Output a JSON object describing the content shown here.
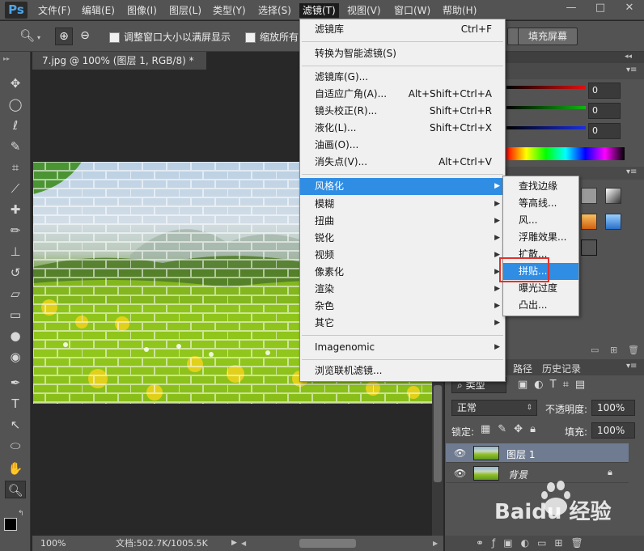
{
  "app": {
    "logo": "Ps"
  },
  "menubar": {
    "items": [
      "文件(F)",
      "编辑(E)",
      "图像(I)",
      "图层(L)",
      "类型(Y)",
      "选择(S)",
      "滤镜(T)",
      "视图(V)",
      "窗口(W)",
      "帮助(H)"
    ],
    "window_controls": [
      "—",
      "□",
      "✕"
    ]
  },
  "options_bar": {
    "zoom_in_icon": "⊕",
    "zoom_out_icon": "⊖",
    "resize_window_label": "调整窗口大小以满屏显示",
    "zoom_all_label": "缩放所有",
    "fill_screen_label": "填充屏幕"
  },
  "document": {
    "tab_title": "7.jpg @ 100% (图层 1, RGB/8) *",
    "zoom": "100%",
    "doc_info": "文档:502.7K/1005.5K"
  },
  "filter_menu": {
    "items": [
      {
        "label": "滤镜库",
        "shortcut": "Ctrl+F"
      },
      {
        "label": "转换为智能滤镜(S)",
        "shortcut": ""
      },
      {
        "label": "滤镜库(G)...",
        "shortcut": ""
      },
      {
        "label": "自适应广角(A)...",
        "shortcut": "Alt+Shift+Ctrl+A"
      },
      {
        "label": "镜头校正(R)...",
        "shortcut": "Shift+Ctrl+R"
      },
      {
        "label": "液化(L)...",
        "shortcut": "Shift+Ctrl+X"
      },
      {
        "label": "油画(O)...",
        "shortcut": ""
      },
      {
        "label": "消失点(V)...",
        "shortcut": "Alt+Ctrl+V"
      },
      {
        "label": "风格化",
        "shortcut": ""
      },
      {
        "label": "模糊",
        "shortcut": ""
      },
      {
        "label": "扭曲",
        "shortcut": ""
      },
      {
        "label": "锐化",
        "shortcut": ""
      },
      {
        "label": "视频",
        "shortcut": ""
      },
      {
        "label": "像素化",
        "shortcut": ""
      },
      {
        "label": "渲染",
        "shortcut": ""
      },
      {
        "label": "杂色",
        "shortcut": ""
      },
      {
        "label": "其它",
        "shortcut": ""
      },
      {
        "label": "Imagenomic",
        "shortcut": ""
      },
      {
        "label": "浏览联机滤镜...",
        "shortcut": ""
      }
    ],
    "submenu_arrow": "▶"
  },
  "stylize_submenu": {
    "items": [
      "查找边缘",
      "等高线...",
      "风...",
      "浮雕效果...",
      "扩散...",
      "拼贴...",
      "曝光过度",
      "凸出..."
    ],
    "highlighted": "拼贴..."
  },
  "color_panel": {
    "values": [
      "0",
      "0",
      "0"
    ]
  },
  "layers_panel": {
    "tabs": [
      "路径",
      "历史记录"
    ],
    "filter_type": "类型",
    "blend_mode": "正常",
    "opacity_label": "不透明度:",
    "opacity_value": "100%",
    "lock_label": "锁定:",
    "fill_label": "填充:",
    "fill_value": "100%",
    "layers": [
      {
        "name": "图层 1",
        "selected": true
      },
      {
        "name": "背景",
        "selected": false,
        "locked": true
      }
    ]
  },
  "watermark": {
    "text": "Baidu 经验"
  },
  "colors": {
    "highlight": "#2f8de4",
    "red_box": "#e0322c",
    "panel": "#535353"
  }
}
